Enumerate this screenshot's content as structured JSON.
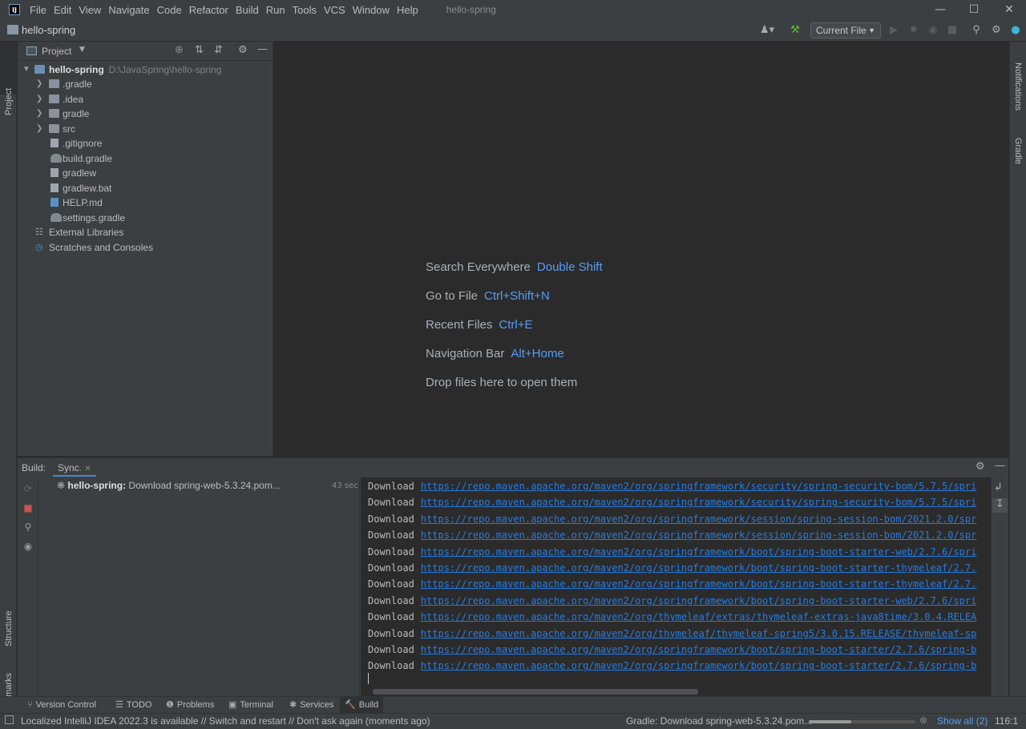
{
  "menu": {
    "items": [
      "File",
      "Edit",
      "View",
      "Navigate",
      "Code",
      "Refactor",
      "Build",
      "Run",
      "Tools",
      "VCS",
      "Window",
      "Help"
    ],
    "window_title": "hello-spring",
    "logo_text": "IJ"
  },
  "navbar": {
    "project_name": "hello-spring",
    "run_config": "Current File"
  },
  "left_stripe": {
    "project": "Project",
    "structure": "Structure",
    "bookmarks": "Bookmarks"
  },
  "right_stripe": {
    "notifications": "Notifications",
    "gradle": "Gradle"
  },
  "project_panel": {
    "title": "Project",
    "root": {
      "name": "hello-spring",
      "path": "D:\\JavaSpring\\hello-spring"
    },
    "items": [
      {
        "label": ".gradle",
        "type": "folder",
        "icon": "folder-icon"
      },
      {
        "label": ".idea",
        "type": "folder",
        "icon": "folder-icon"
      },
      {
        "label": "gradle",
        "type": "folder",
        "icon": "folder-icon"
      },
      {
        "label": "src",
        "type": "folder",
        "icon": "folder-icon"
      },
      {
        "label": ".gitignore",
        "type": "file",
        "icon": "gitignore-file-icon"
      },
      {
        "label": "build.gradle",
        "type": "file",
        "icon": "gradle-file-icon"
      },
      {
        "label": "gradlew",
        "type": "file",
        "icon": "script-file-icon"
      },
      {
        "label": "gradlew.bat",
        "type": "file",
        "icon": "text-file-icon"
      },
      {
        "label": "HELP.md",
        "type": "file",
        "icon": "markdown-file-icon"
      },
      {
        "label": "settings.gradle",
        "type": "file",
        "icon": "gradle-file-icon"
      }
    ],
    "external_libraries": "External Libraries",
    "scratches": "Scratches and Consoles"
  },
  "editor_hints": [
    {
      "label": "Search Everywhere",
      "key": "Double Shift"
    },
    {
      "label": "Go to File",
      "key": "Ctrl+Shift+N"
    },
    {
      "label": "Recent Files",
      "key": "Ctrl+E"
    },
    {
      "label": "Navigation Bar",
      "key": "Alt+Home"
    },
    {
      "label": "Drop files here to open them",
      "key": ""
    }
  ],
  "build": {
    "label": "Build:",
    "tab": "Sync",
    "task": {
      "project": "hello-spring:",
      "message": "Download spring-web-5.3.24.pom...",
      "duration": "43 sec"
    },
    "console_word": "Download",
    "console_urls": [
      "https://repo.maven.apache.org/maven2/org/springframework/security/spring-security-bom/5.7.5/spri",
      "https://repo.maven.apache.org/maven2/org/springframework/security/spring-security-bom/5.7.5/spri",
      "https://repo.maven.apache.org/maven2/org/springframework/session/spring-session-bom/2021.2.0/spr",
      "https://repo.maven.apache.org/maven2/org/springframework/session/spring-session-bom/2021.2.0/spr",
      "https://repo.maven.apache.org/maven2/org/springframework/boot/spring-boot-starter-web/2.7.6/spri",
      "https://repo.maven.apache.org/maven2/org/springframework/boot/spring-boot-starter-thymeleaf/2.7.",
      "https://repo.maven.apache.org/maven2/org/springframework/boot/spring-boot-starter-thymeleaf/2.7.",
      "https://repo.maven.apache.org/maven2/org/springframework/boot/spring-boot-starter-web/2.7.6/spri",
      "https://repo.maven.apache.org/maven2/org/thymeleaf/extras/thymeleaf-extras-java8time/3.0.4.RELEA",
      "https://repo.maven.apache.org/maven2/org/thymeleaf/thymeleaf-spring5/3.0.15.RELEASE/thymeleaf-sp",
      "https://repo.maven.apache.org/maven2/org/springframework/boot/spring-boot-starter/2.7.6/spring-b",
      "https://repo.maven.apache.org/maven2/org/springframework/boot/spring-boot-starter/2.7.6/spring-b"
    ]
  },
  "bottom_tabs": [
    {
      "label": "Version Control",
      "icon": "version-control-icon",
      "glyph": "⑂"
    },
    {
      "label": "TODO",
      "icon": "todo-icon",
      "glyph": "☰"
    },
    {
      "label": "Problems",
      "icon": "problems-icon",
      "glyph": "❶"
    },
    {
      "label": "Terminal",
      "icon": "terminal-icon",
      "glyph": "▣"
    },
    {
      "label": "Services",
      "icon": "services-icon",
      "glyph": "✱"
    },
    {
      "label": "Build",
      "icon": "hammer-icon",
      "glyph": "🔨"
    }
  ],
  "status": {
    "message": "Localized IntelliJ IDEA 2022.3 is available // Switch and restart // Don't ask again (moments ago)",
    "gradle_task": "Gradle: Download spring-web-5.3.24.pom...",
    "show_all": "Show all (2)",
    "caret": "116:1",
    "progress": 0.4
  },
  "colors": {
    "link": "#287bde",
    "shortcut": "#589df6",
    "accent": "#4a88c7",
    "stop": "#c75450"
  }
}
